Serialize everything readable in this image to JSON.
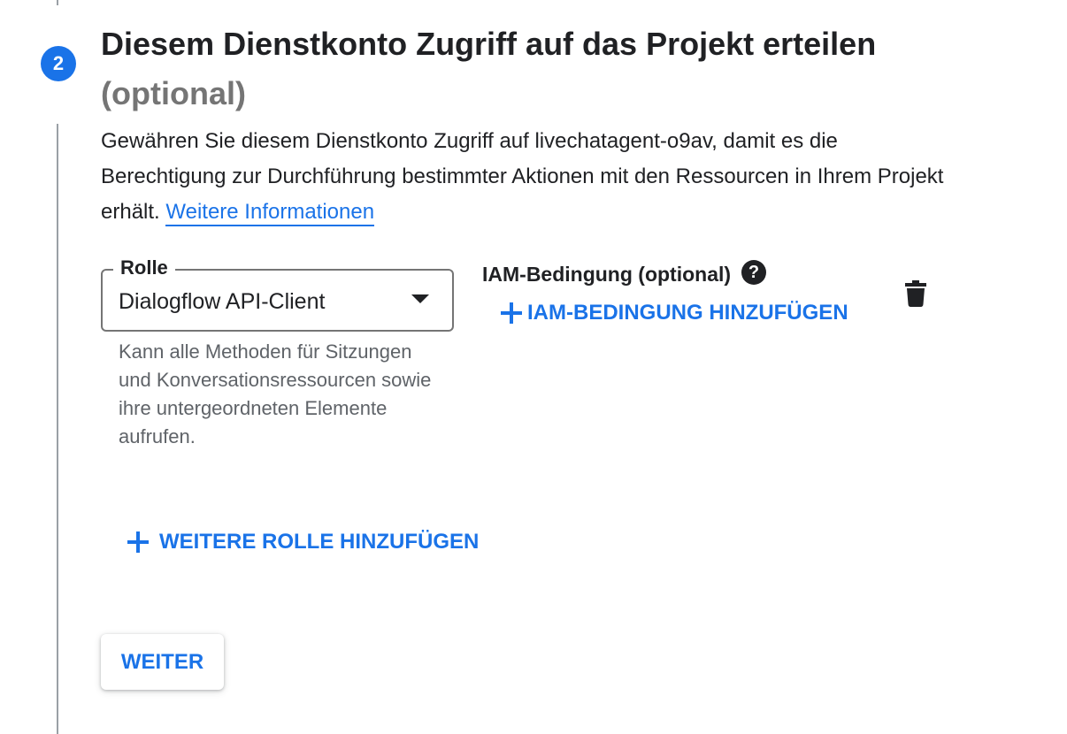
{
  "step": {
    "number": "2",
    "title": "Diesem Dienstkonto Zugriff auf das Projekt erteilen",
    "subtitle": "(optional)"
  },
  "description": {
    "text": "Gewähren Sie diesem Dienstkonto Zugriff auf livechatagent-o9av, damit es die Berechtigung zur Durchführung bestimmter Aktionen mit den Ressourcen in Ihrem Projekt erhält.",
    "link_label": "Weitere Informationen"
  },
  "role": {
    "label": "Rolle",
    "selected_value": "Dialogflow API-Client",
    "description": "Kann alle Methoden für Sitzungen und Konversationsressourcen sowie ihre untergeordneten Elemente aufrufen."
  },
  "iam_condition": {
    "label": "IAM-Bedingung (optional)",
    "help_icon": "question-mark",
    "add_label": "IAM-BEDINGUNG HINZUFÜGEN"
  },
  "delete_icon": "trash",
  "add_role_label": "WEITERE ROLLE HINZUFÜGEN",
  "continue_label": "WEITER",
  "colors": {
    "accent": "#1a73e8",
    "step_line": "#9aa0a6",
    "muted_text": "#5f6368",
    "text": "#202124"
  }
}
